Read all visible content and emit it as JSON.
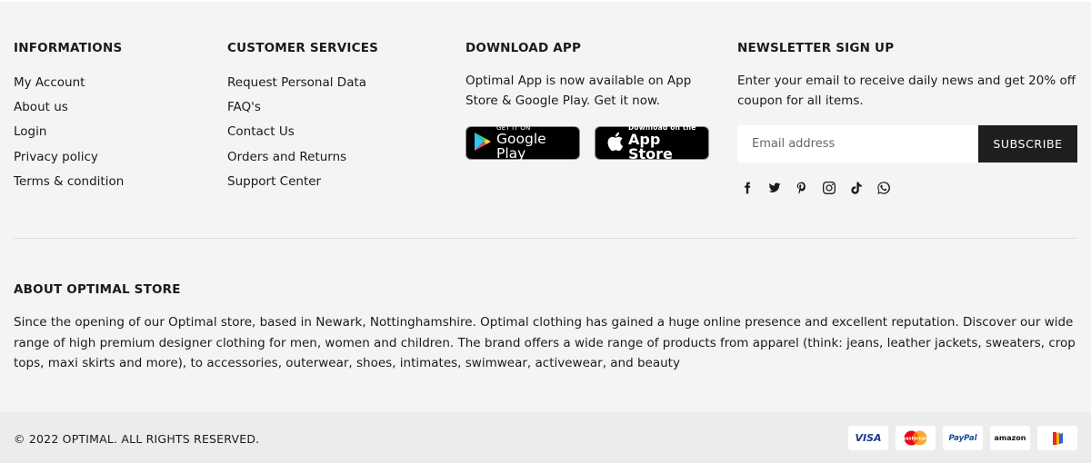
{
  "informations": {
    "heading": "INFORMATIONS",
    "links": [
      "My Account",
      "About us",
      "Login",
      "Privacy policy",
      "Terms & condition"
    ]
  },
  "customer_services": {
    "heading": "CUSTOMER SERVICES",
    "links": [
      "Request Personal Data",
      "FAQ's",
      "Contact Us",
      "Orders and Returns",
      "Support Center"
    ]
  },
  "download_app": {
    "heading": "DOWNLOAD APP",
    "description": "Optimal App is now available on App Store & Google Play. Get it now.",
    "google_play": {
      "small": "GET IT ON",
      "big": "Google Play"
    },
    "app_store": {
      "small": "Download on the",
      "big": "App Store"
    }
  },
  "newsletter": {
    "heading": "NEWSLETTER SIGN UP",
    "description": "Enter your email to receive daily news and get 20% off coupon for all items.",
    "email_placeholder": "Email address",
    "subscribe_label": "SUBSCRIBE",
    "socials": [
      "facebook-icon",
      "twitter-icon",
      "pinterest-icon",
      "instagram-icon",
      "tiktok-icon",
      "whatsapp-icon"
    ]
  },
  "about": {
    "heading": "ABOUT OPTIMAL STORE",
    "text": "Since the opening of our Optimal store, based in Newark, Nottinghamshire. Optimal clothing has gained a huge online presence and excellent reputation. Discover our wide range of high premium designer clothing for men, women and children. The brand offers a wide range of products from apparel (think: jeans, leather jackets, sweaters, crop tops, maxi skirts and more), to accessories, outerwear, shoes, intimates, swimwear, activewear, and beauty"
  },
  "footer": {
    "copyright": "© 2022 OPTIMAL. ALL RIGHTS RESERVED.",
    "payments": {
      "visa": "VISA",
      "mastercard": "mastercard",
      "paypal": "PayPal",
      "amazon": "amazon",
      "other": "payment-icon"
    }
  }
}
